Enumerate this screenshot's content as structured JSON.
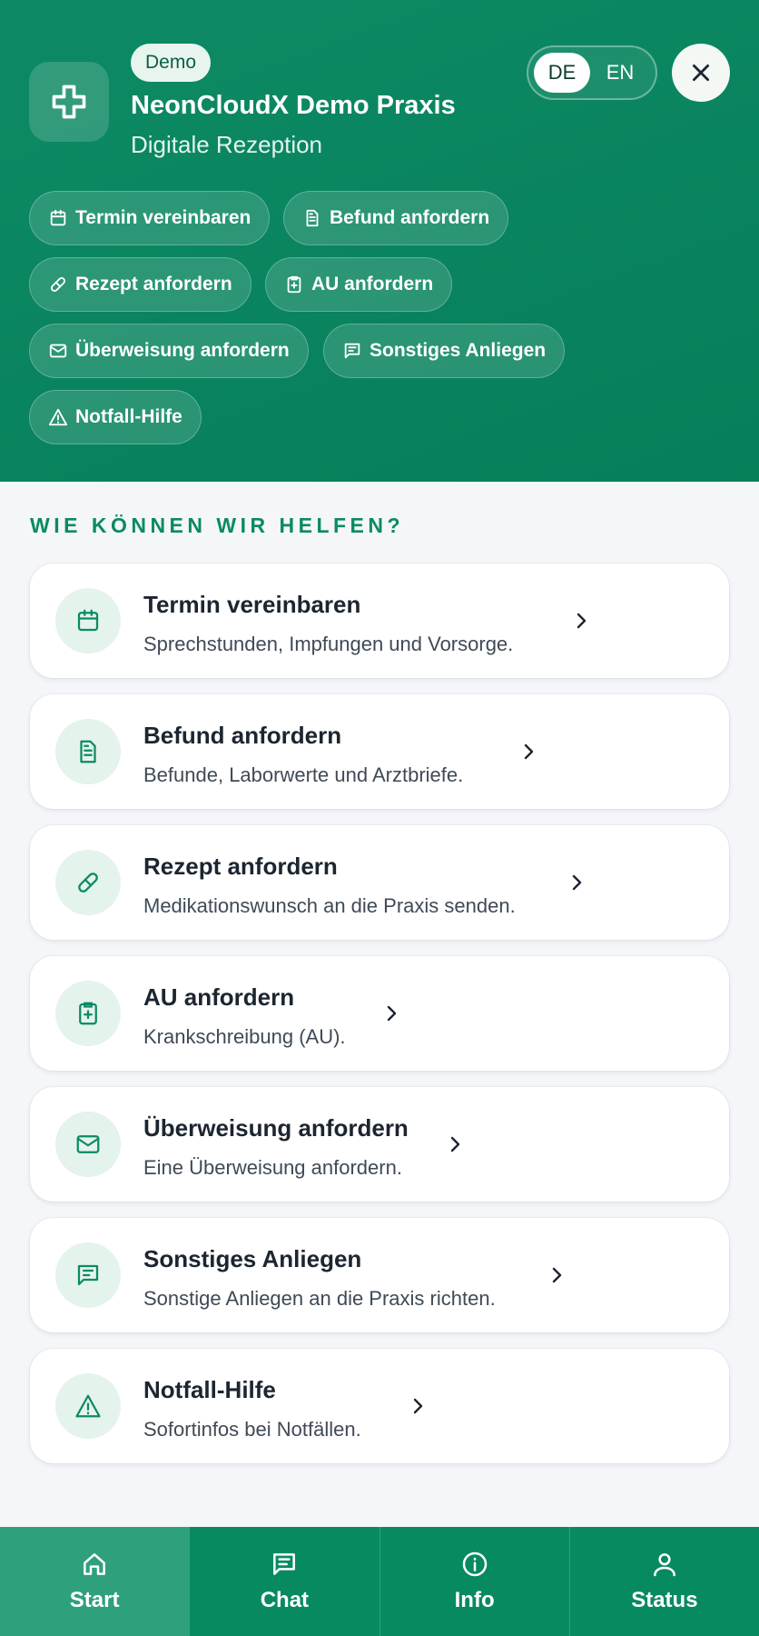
{
  "header": {
    "badge": "Demo",
    "practice_name": "NeonCloudX Demo Praxis",
    "subtitle": "Digitale Rezeption",
    "languages": [
      "DE",
      "EN"
    ],
    "active_language": "DE",
    "close_icon": "close-icon",
    "logo_icon": "medical-cross-icon"
  },
  "quick_actions": [
    {
      "label": "Termin vereinbaren",
      "icon": "calendar-icon"
    },
    {
      "label": "Befund anfordern",
      "icon": "document-icon"
    },
    {
      "label": "Rezept anfordern",
      "icon": "pill-icon"
    },
    {
      "label": "AU anfordern",
      "icon": "clipboard-plus-icon"
    },
    {
      "label": "Überweisung anfordern",
      "icon": "mail-icon"
    },
    {
      "label": "Sonstiges Anliegen",
      "icon": "message-icon"
    },
    {
      "label": "Notfall-Hilfe",
      "icon": "warning-icon"
    }
  ],
  "section": {
    "title": "WIE KÖNNEN WIR HELFEN?"
  },
  "services": [
    {
      "title": "Termin vereinbaren",
      "desc": "Sprechstunden, Impfungen und Vorsorge.",
      "icon": "calendar-icon"
    },
    {
      "title": "Befund anfordern",
      "desc": "Befunde, Laborwerte und Arztbriefe.",
      "icon": "document-icon"
    },
    {
      "title": "Rezept anfordern",
      "desc": "Medikationswunsch an die Praxis senden.",
      "icon": "pill-icon"
    },
    {
      "title": "AU anfordern",
      "desc": "Krankschreibung (AU).",
      "icon": "clipboard-plus-icon"
    },
    {
      "title": "Überweisung anfordern",
      "desc": "Eine Überweisung anfordern.",
      "icon": "mail-icon"
    },
    {
      "title": "Sonstiges Anliegen",
      "desc": "Sonstige Anliegen an die Praxis richten.",
      "icon": "message-icon"
    },
    {
      "title": "Notfall-Hilfe",
      "desc": "Sofortinfos bei Notfällen.",
      "icon": "warning-icon"
    }
  ],
  "nav": [
    {
      "label": "Start",
      "icon": "home-icon",
      "active": true
    },
    {
      "label": "Chat",
      "icon": "chat-icon",
      "active": false
    },
    {
      "label": "Info",
      "icon": "info-icon",
      "active": false
    },
    {
      "label": "Status",
      "icon": "user-icon",
      "active": false
    }
  ],
  "colors": {
    "primary": "#078a62",
    "primary_light": "#e4f3ec",
    "background": "#f4f6f9"
  }
}
